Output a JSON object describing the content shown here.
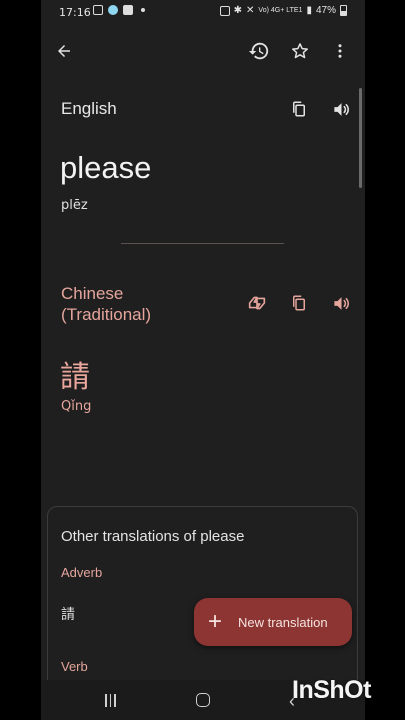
{
  "status_bar": {
    "time": "17:16",
    "network": "Vo) 4G+ LTE1",
    "battery": "47%"
  },
  "toolbar": {
    "back": "arrow-left-icon",
    "history": "history-icon",
    "favorite": "star-outline-icon",
    "more": "more-vertical-icon"
  },
  "source": {
    "language": "English",
    "text": "please",
    "transliteration": "plēz"
  },
  "target": {
    "language": "Chinese (Traditional)",
    "text": "請",
    "transliteration": "Qǐng"
  },
  "other_translations": {
    "title": "Other translations of please",
    "groups": [
      {
        "pos": "Adverb",
        "words": [
          "請"
        ]
      },
      {
        "pos": "Verb",
        "words": []
      }
    ]
  },
  "fab": {
    "label": "New translation"
  },
  "watermark": "InShOt",
  "colors": {
    "background": "#1f1f1f",
    "accent": "#e5a59c",
    "fab": "#8c3532"
  }
}
